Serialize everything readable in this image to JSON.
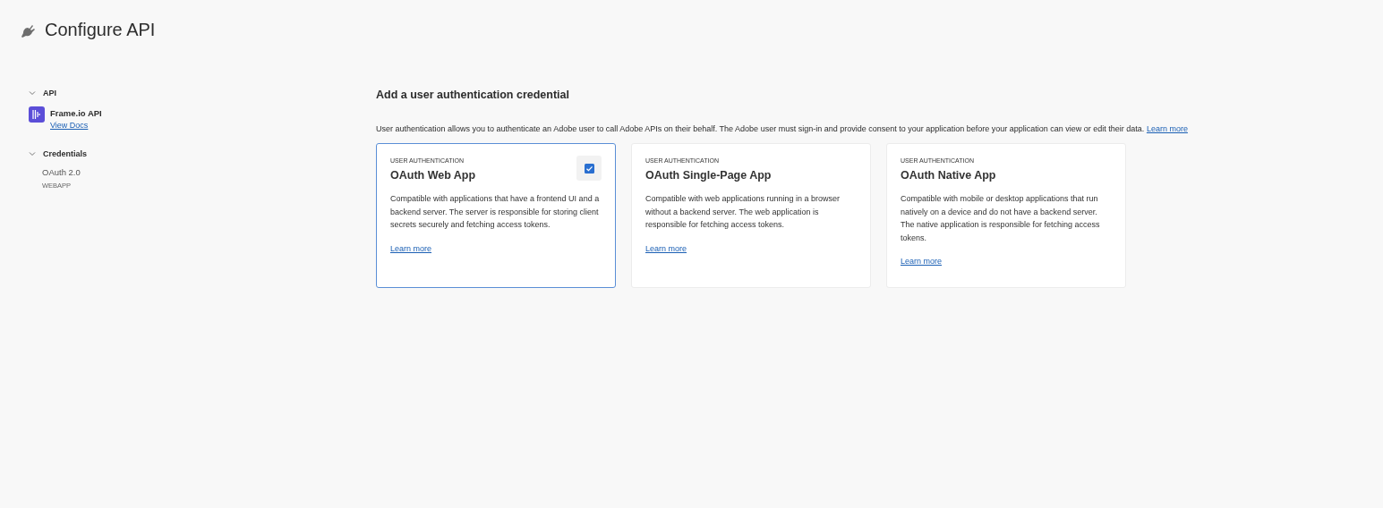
{
  "header": {
    "title": "Configure API"
  },
  "sidebar": {
    "sections": [
      {
        "label": "API",
        "expanded": true,
        "items": [
          {
            "kind": "api",
            "name": "Frame.io API",
            "link": "View Docs"
          }
        ]
      },
      {
        "label": "Credentials",
        "expanded": true,
        "items": [
          {
            "kind": "credential",
            "name": "OAuth 2.0",
            "sub": "WEBAPP"
          }
        ]
      }
    ]
  },
  "main": {
    "heading": "Add a user authentication credential",
    "description": "User authentication allows you to authenticate an Adobe user to call Adobe APIs on their behalf. The Adobe user must sign-in and provide consent to your application before your application can view or edit their data.",
    "description_link": "Learn more",
    "cards": [
      {
        "eyebrow": "USER AUTHENTICATION",
        "title": "OAuth Web App",
        "text": "Compatible with applications that have a frontend UI and a backend server. The server is responsible for storing client secrets securely and fetching access tokens.",
        "link": "Learn more",
        "selected": true
      },
      {
        "eyebrow": "USER AUTHENTICATION",
        "title": "OAuth Single-Page App",
        "text": "Compatible with web applications running in a browser without a backend server. The web application is responsible for fetching access tokens.",
        "link": "Learn more",
        "selected": false
      },
      {
        "eyebrow": "USER AUTHENTICATION",
        "title": "OAuth Native App",
        "text": "Compatible with mobile or desktop applications that run natively on a device and do not have a backend server. The native application is responsible for fetching access tokens.",
        "link": "Learn more",
        "selected": false
      }
    ]
  }
}
